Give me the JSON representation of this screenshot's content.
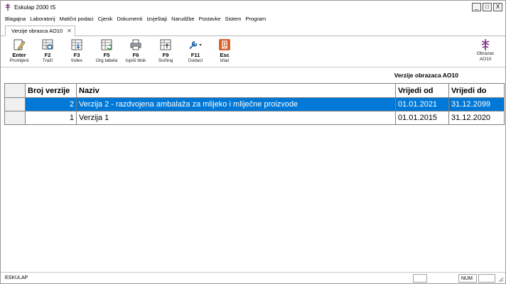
{
  "window": {
    "title": "Eskulap 2000  IS",
    "controls": [
      "_",
      "□",
      "X"
    ]
  },
  "menu": [
    "Blagajna",
    "Laboratorij",
    "Matični podaci",
    "Cjenik",
    "Dokumenti",
    "Izvještaji",
    "Narudžbe",
    "Postavke",
    "Sistem",
    "Program"
  ],
  "tab": {
    "label": "Verzije obrasca AO10",
    "close": "✕"
  },
  "toolbar": {
    "tools": [
      {
        "key": "Enter",
        "label": "Promijeni",
        "icon": "edit-document-icon"
      },
      {
        "key": "F2",
        "label": "Traži",
        "icon": "search-table-icon"
      },
      {
        "key": "F3",
        "label": "Index",
        "icon": "index-table-icon"
      },
      {
        "key": "F5",
        "label": "Org.tabela",
        "icon": "refresh-table-icon"
      },
      {
        "key": "F6",
        "label": "Ispiši blok",
        "icon": "printer-icon"
      },
      {
        "key": "F9",
        "label": "Sortiraj",
        "icon": "sort-table-icon"
      },
      {
        "key": "F11",
        "label": "Dodaci",
        "icon": "wrench-icon"
      },
      {
        "key": "Esc",
        "label": "Izlaz",
        "icon": "exit-icon"
      }
    ],
    "right_tool": {
      "line1": "Obrazac",
      "line2": "AO10",
      "icon": "caduceus-icon"
    }
  },
  "form_title": "Verzije obrazaca AO10",
  "grid": {
    "columns": [
      "Broj verzije",
      "Naziv",
      "Vrijedi od",
      "Vrijedi do"
    ],
    "rows": [
      {
        "broj": "2",
        "naziv": "Verzija 2 - razdvojena ambalaža za mlijeko i mliječne proizvode",
        "od": "01.01.2021",
        "do": "31.12.2099",
        "selected": true
      },
      {
        "broj": "1",
        "naziv": "Verzija 1",
        "od": "01.01.2015",
        "do": "31.12.2020",
        "selected": false
      }
    ]
  },
  "status": {
    "left": "ESKULAP",
    "num": "NUM"
  },
  "colors": {
    "selection": "#0078d7",
    "exit_icon": "#d9622b",
    "caduceus": "#7a2a7a"
  }
}
